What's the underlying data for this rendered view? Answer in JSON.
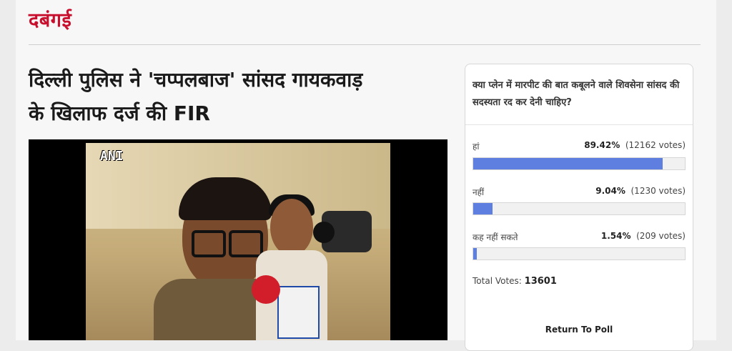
{
  "section": {
    "title": "दबंगई"
  },
  "article": {
    "headline_line1": "दिल्ली पुलिस ने 'चप्पलबाज' सांसद गायकवाड़",
    "headline_line2": "के खिलाफ दर्ज की FIR",
    "video": {
      "watermark": "ANI"
    }
  },
  "poll": {
    "question": "क्या प्लेन में मारपीट की बात कबूलने वाले शिवसेना सांसद की सदस्यता रद कर देनी चाहिए?",
    "options": [
      {
        "label": "हां",
        "percent": "89.42%",
        "votes": "(12162 votes)",
        "fraction": 0.8942
      },
      {
        "label": "नहीं",
        "percent": "9.04%",
        "votes": "(1230 votes)",
        "fraction": 0.0904
      },
      {
        "label": "कह नहीं सकते",
        "percent": "1.54%",
        "votes": "(209 votes)",
        "fraction": 0.0154
      }
    ],
    "total_label": "Total Votes:",
    "total_value": "13601",
    "return_label": "Return To Poll",
    "bar_color": "#5e7fe0"
  }
}
